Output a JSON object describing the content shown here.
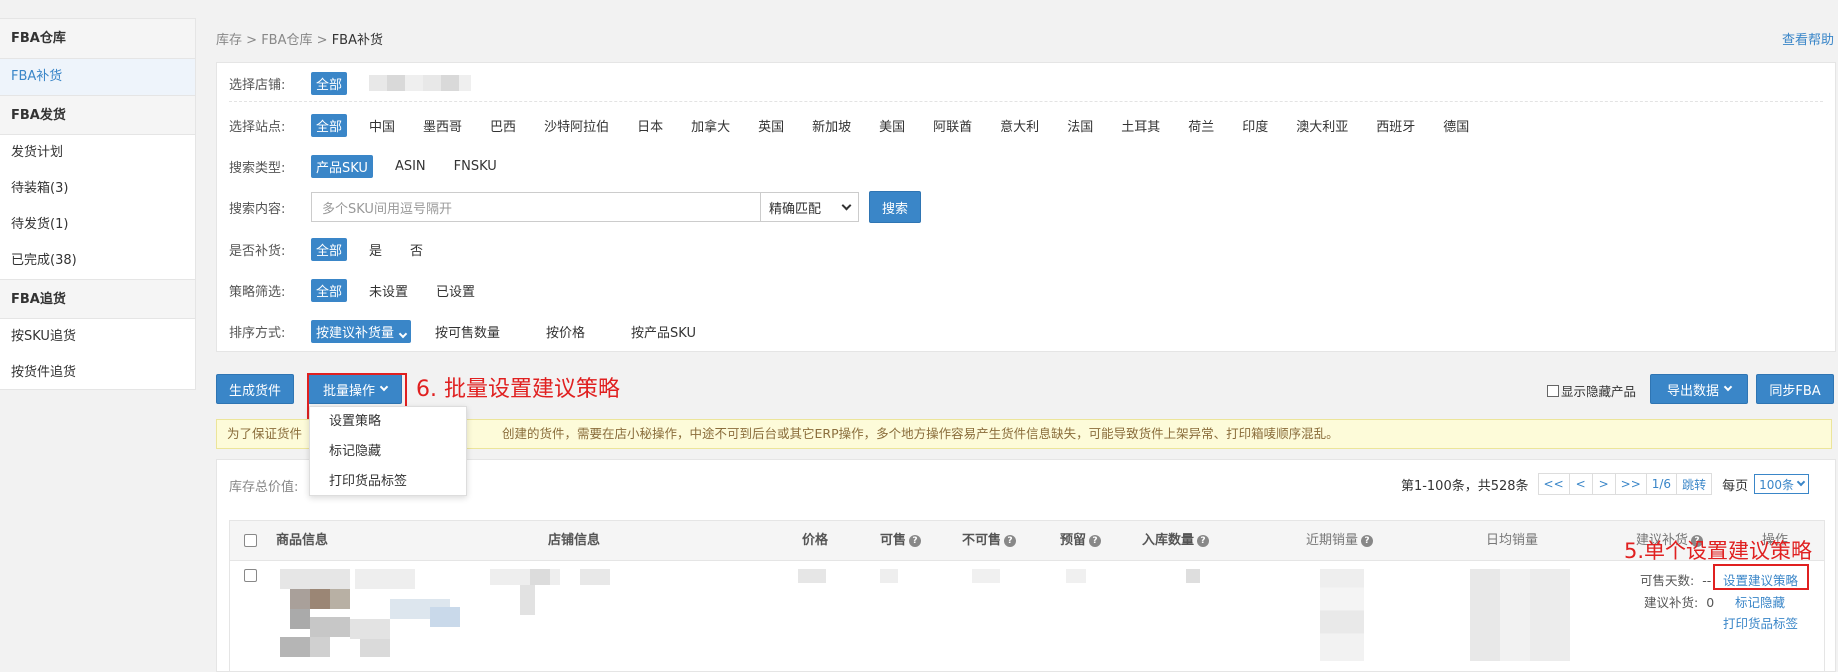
{
  "sidebar": {
    "sections": [
      {
        "title": "FBA仓库",
        "items": [
          "FBA补货"
        ]
      },
      {
        "title": "FBA发货",
        "items": [
          "发货计划",
          "待装箱(3)",
          "待发货(1)",
          "已完成(38)"
        ]
      },
      {
        "title": "FBA追货",
        "items": [
          "按SKU追货",
          "按货件追货"
        ]
      }
    ],
    "active_item": "FBA补货"
  },
  "breadcrumb": {
    "items": [
      "库存",
      "FBA仓库",
      "FBA补货"
    ],
    "separator": ">"
  },
  "help_link": "查看帮助",
  "filters": {
    "shop": {
      "label": "选择店铺:",
      "selected": "全部"
    },
    "site": {
      "label": "选择站点:",
      "selected": "全部",
      "options": [
        "中国",
        "墨西哥",
        "巴西",
        "沙特阿拉伯",
        "日本",
        "加拿大",
        "英国",
        "新加坡",
        "美国",
        "阿联酋",
        "意大利",
        "法国",
        "土耳其",
        "荷兰",
        "印度",
        "澳大利亚",
        "西班牙",
        "德国"
      ]
    },
    "search_type": {
      "label": "搜索类型:",
      "selected": "产品SKU",
      "options": [
        "ASIN",
        "FNSKU"
      ]
    },
    "search_content": {
      "label": "搜索内容:",
      "placeholder": "多个SKU间用逗号隔开",
      "match_mode": "精确匹配",
      "search_button": "搜索"
    },
    "replenish": {
      "label": "是否补货:",
      "selected": "全部",
      "options": [
        "是",
        "否"
      ]
    },
    "strategy": {
      "label": "策略筛选:",
      "selected": "全部",
      "options": [
        "未设置",
        "已设置"
      ]
    },
    "sort": {
      "label": "排序方式:",
      "selected": "按建议补货量",
      "options": [
        "按可售数量",
        "按价格",
        "按产品SKU"
      ]
    }
  },
  "toolbar": {
    "generate_shipment": "生成货件",
    "batch_ops": "批量操作",
    "show_hidden": "显示隐藏产品",
    "export": "导出数据",
    "sync": "同步FBA"
  },
  "batch_menu": {
    "items": [
      "设置策略",
      "标记隐藏",
      "打印货品标签"
    ]
  },
  "annotations": {
    "batch": "6. 批量设置建议策略",
    "single": "5.单个设置建议策略"
  },
  "notice": "为了保证货件                                        创建的货件，需要在店小秘操作，中途不可到后台或其它ERP操作，多个地方操作容易产生货件信息缺失，可能导致货件上架异常、打印箱唛顺序混乱。",
  "notice_left": "为了保证货件",
  "notice_right": "创建的货件，需要在店小秘操作，中途不可到后台或其它ERP操作，多个地方操作容易产生货件信息缺失，可能导致货件上架异常、打印箱唛顺序混乱。",
  "list": {
    "stock_total_label": "库存总价值:",
    "pager": {
      "summary": "第1-100条，共528条",
      "first": "<<",
      "prev": "<",
      "next": ">",
      "last": ">>",
      "page": "1/6",
      "jump": "跳转",
      "per_page_label": "每页",
      "per_page": "100条"
    },
    "columns": [
      "商品信息",
      "店铺信息",
      "价格",
      "可售",
      "不可售",
      "预留",
      "入库数量",
      "近期销量",
      "日均销量",
      "建议补货",
      "操作"
    ],
    "row": {
      "available_days_label": "可售天数:",
      "available_days": "--",
      "suggest_label": "建议补货:",
      "suggest": "0",
      "actions": [
        "设置建议策略",
        "标记隐藏",
        "打印货品标签"
      ]
    }
  },
  "colors": {
    "accent": "#3a86c8",
    "annotation": "#e02020",
    "notice_bg": "#fdfbd9"
  }
}
